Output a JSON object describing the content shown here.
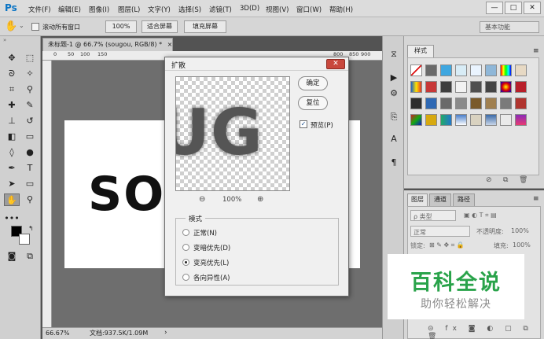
{
  "app": {
    "logo": "Ps"
  },
  "menu": [
    "文件(F)",
    "编辑(E)",
    "图像(I)",
    "图层(L)",
    "文字(Y)",
    "选择(S)",
    "滤镜(T)",
    "3D(D)",
    "视图(V)",
    "窗口(W)",
    "帮助(H)"
  ],
  "window_controls": {
    "minimize": "—",
    "maximize": "□",
    "close": "✕"
  },
  "options_bar": {
    "scroll_all_label": "滚动所有窗口",
    "zoom_100": "100%",
    "fit_screen": "适合屏幕",
    "fill_screen": "填充屏幕",
    "workspace": "基本功能"
  },
  "document": {
    "tab_title": "未标题-1 @ 66.7% (sougou, RGB/8) *",
    "tab_close": "×",
    "canvas_text": "SO",
    "ruler_ticks": [
      "0",
      "50",
      "100",
      "150",
      "800",
      "850",
      "900"
    ],
    "zoom": "66.67%",
    "doc_info": "文档:937.5K/1.09M"
  },
  "styles_panel": {
    "tab": "样式"
  },
  "layers_panel": {
    "tabs": [
      "图层",
      "通道",
      "路径"
    ],
    "filter_kind": "ρ 类型",
    "blend_mode": "正常",
    "opacity_label": "不透明度:",
    "opacity_value": "100%",
    "lock_label": "锁定:",
    "fill_label": "填充:",
    "fill_value": "100%"
  },
  "watermark": {
    "title": "百科全说",
    "subtitle": "助你轻松解决"
  },
  "dialog": {
    "title": "扩散",
    "close": "✕",
    "preview_text": "UG",
    "ok": "确定",
    "reset": "复位",
    "preview_label": "预览(P)",
    "preview_checked": "✓",
    "zoom_out": "⊖",
    "zoom_percent": "100%",
    "zoom_in": "⊕",
    "mode_legend": "模式",
    "modes": [
      "正常(N)",
      "变暗优先(D)",
      "变亮优先(L)",
      "各向异性(A)"
    ],
    "selected_mode_index": 2
  },
  "colors": {
    "accent_green": "#29a34a",
    "close_red": "#c9483d",
    "ps_blue": "#0b74c4"
  }
}
